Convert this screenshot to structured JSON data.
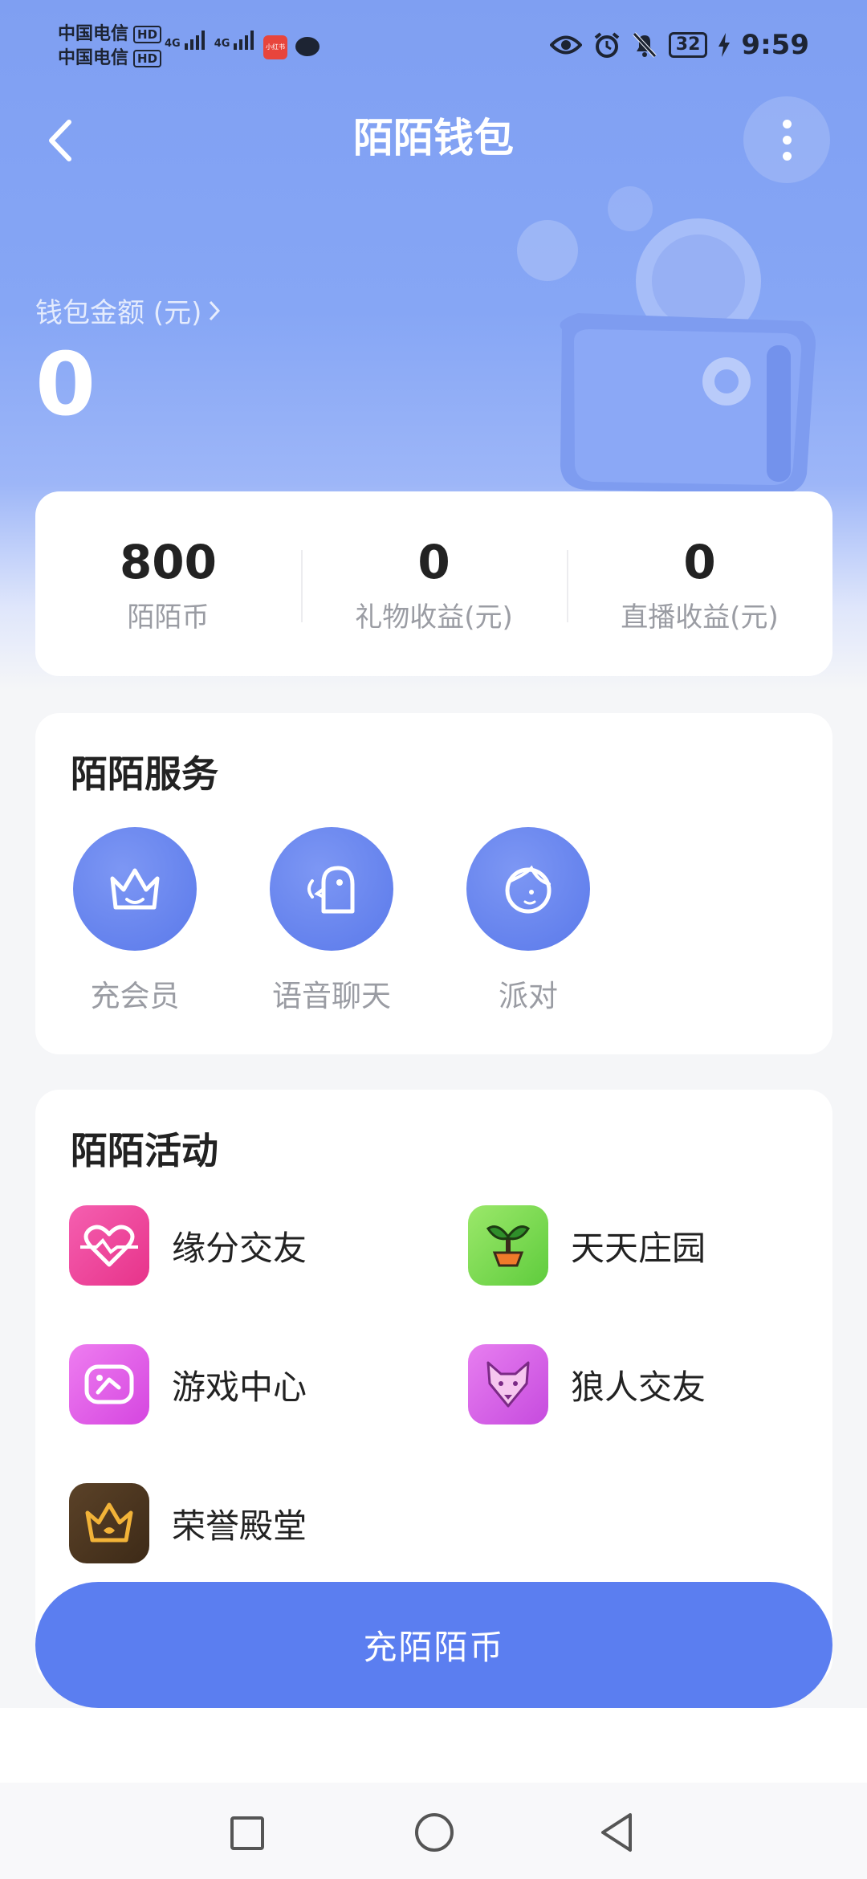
{
  "status_bar": {
    "carrier_1": "中国电信",
    "carrier_2": "中国电信",
    "hd_badge": "HD",
    "network_1": "4G",
    "network_2": "4G",
    "app_badge_text": "小红书",
    "battery": "32",
    "time": "9:59"
  },
  "header": {
    "title": "陌陌钱包"
  },
  "balance": {
    "label": "钱包金额 (元)",
    "value": "0"
  },
  "stats": [
    {
      "value": "800",
      "label": "陌陌币"
    },
    {
      "value": "0",
      "label": "礼物收益(元)"
    },
    {
      "value": "0",
      "label": "直播收益(元)"
    }
  ],
  "services": {
    "title": "陌陌服务",
    "items": [
      {
        "label": "充会员",
        "icon": "crown-icon"
      },
      {
        "label": "语音聊天",
        "icon": "voice-chat-icon"
      },
      {
        "label": "派对",
        "icon": "party-icon"
      }
    ]
  },
  "activities": {
    "title": "陌陌活动",
    "items": [
      {
        "label": "缘分交友",
        "icon": "heart-icon",
        "color": "#f0479c"
      },
      {
        "label": "天天庄园",
        "icon": "sprout-icon",
        "color": "#7ed957"
      },
      {
        "label": "游戏中心",
        "icon": "gamepad-icon",
        "color": "#e15ee8"
      },
      {
        "label": "狼人交友",
        "icon": "wolf-icon",
        "color": "#d55ee6"
      },
      {
        "label": "荣誉殿堂",
        "icon": "honor-crown-icon",
        "color": "#4b3520"
      }
    ]
  },
  "recharge_button": {
    "label": "充陌陌币"
  },
  "colors": {
    "accent": "#5b7ef0",
    "hero_top": "#7f9ff2"
  }
}
